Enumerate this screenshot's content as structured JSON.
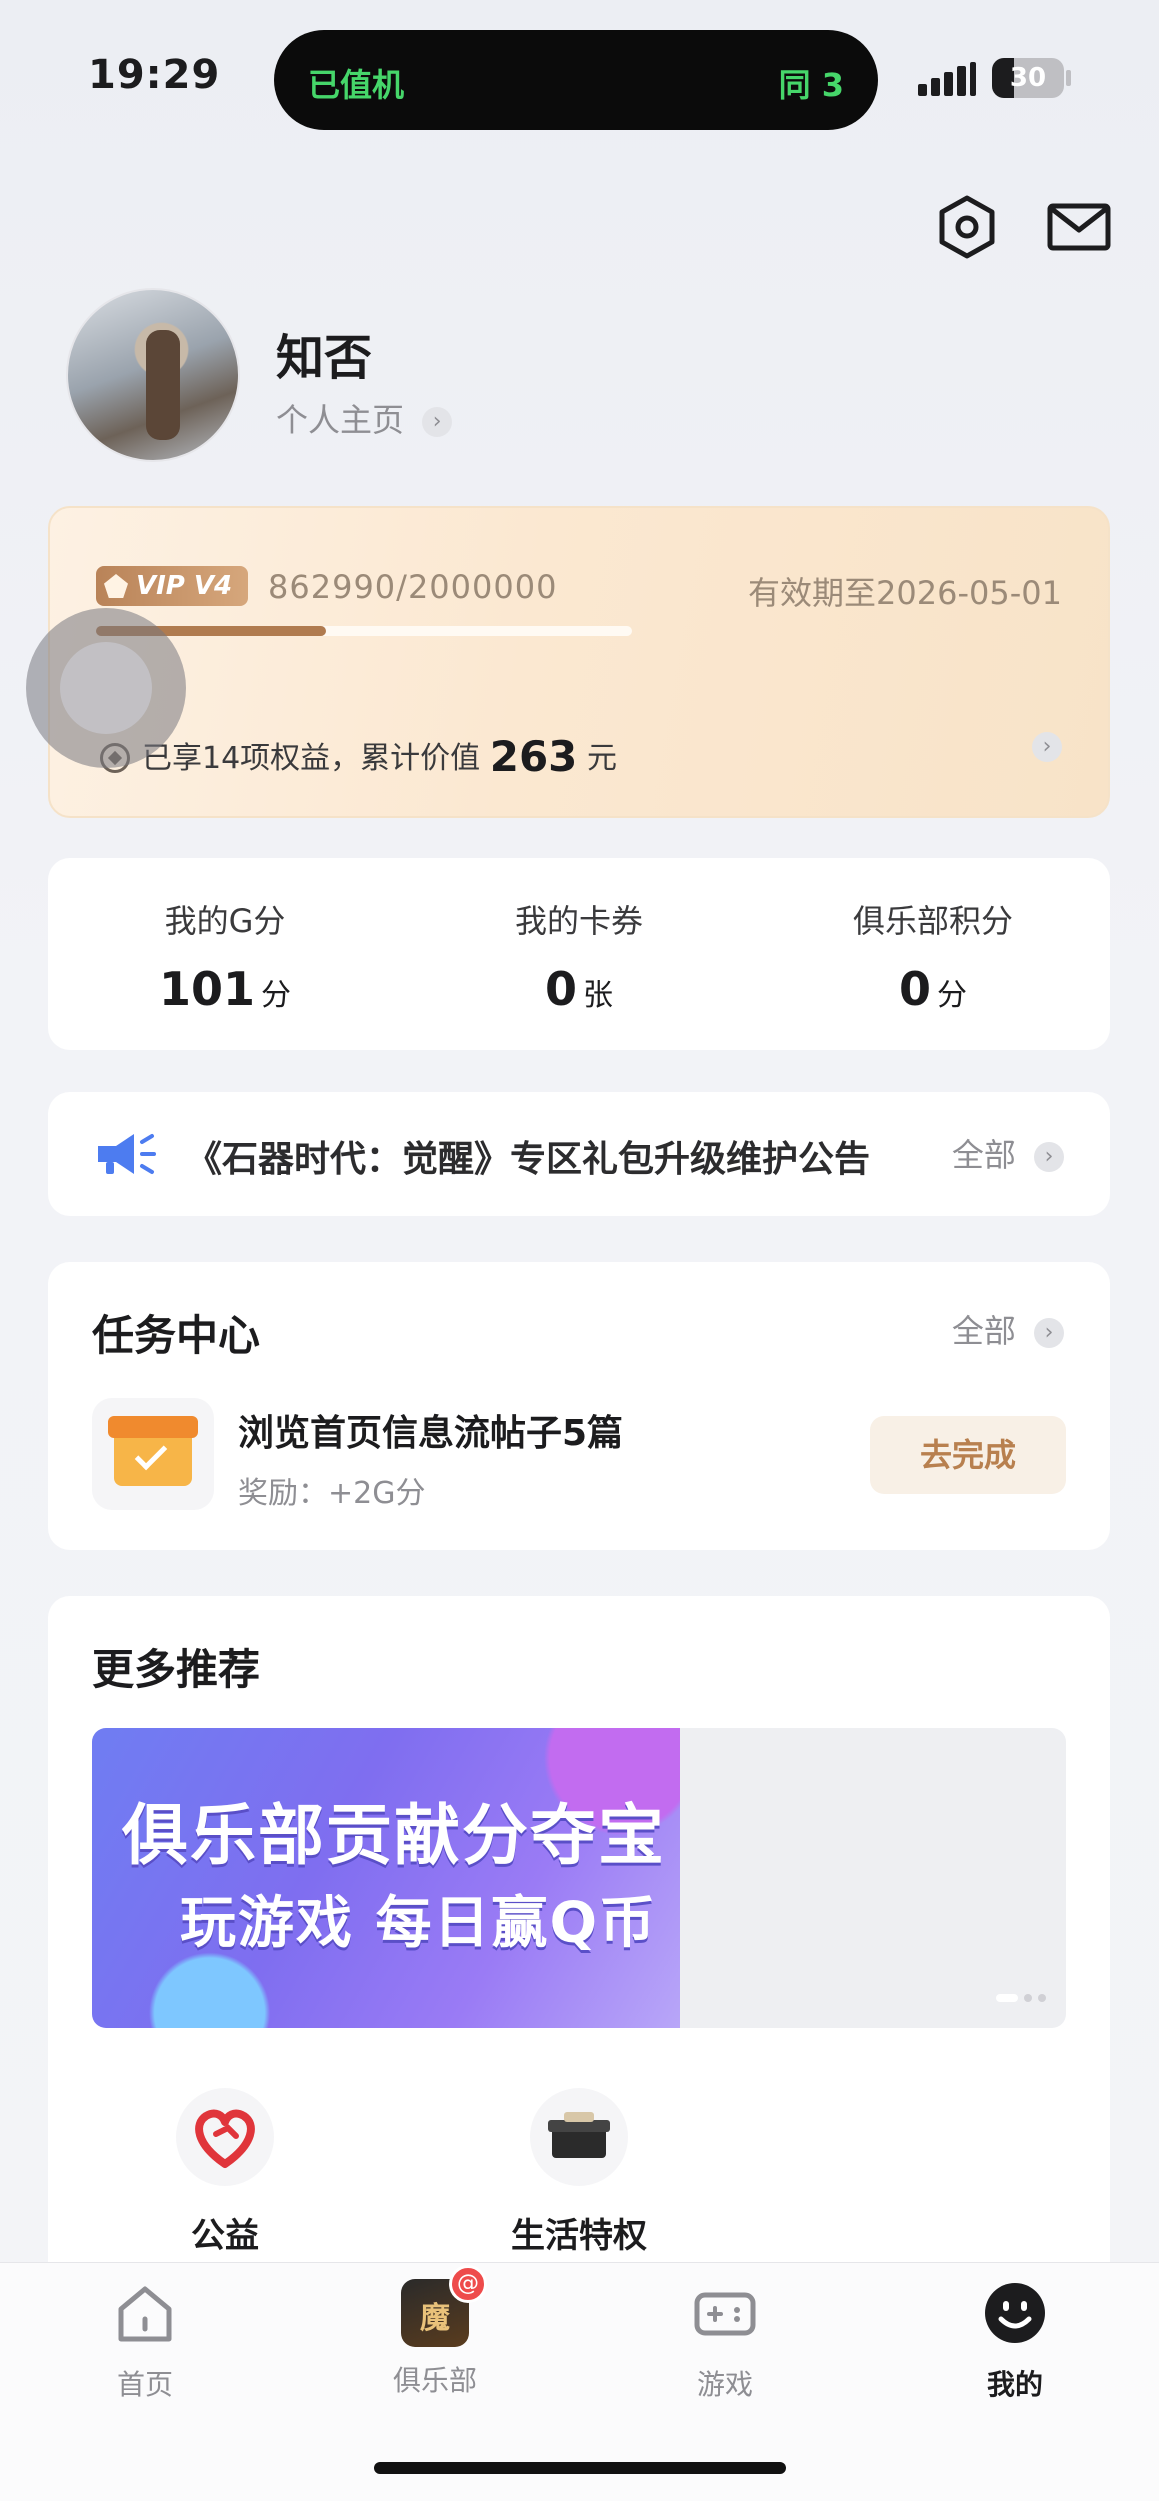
{
  "status_bar": {
    "time": "19:29",
    "island_left": "已值机",
    "island_right": "同 3",
    "battery": "30",
    "battery_level": 0.3
  },
  "header": {
    "icons": [
      "settings-icon",
      "mail-icon"
    ]
  },
  "profile": {
    "name": "知否",
    "homepage_link": "个人主页"
  },
  "vip": {
    "badge": "VIP V4",
    "progress_text": "862990/2000000",
    "progress_fraction": 0.43,
    "expire": "有效期至2026-05-01",
    "benefits_prefix": "已享14项权益，累计价值",
    "benefits_amount": "263",
    "benefits_suffix": "元"
  },
  "stats": [
    {
      "label": "我的G分",
      "value": "101",
      "unit": "分"
    },
    {
      "label": "我的卡券",
      "value": "0",
      "unit": "张"
    },
    {
      "label": "俱乐部积分",
      "value": "0",
      "unit": "分"
    }
  ],
  "notice": {
    "text": "《石器时代：觉醒》专区礼包升级维护公告",
    "all": "全部"
  },
  "tasks": {
    "title": "任务中心",
    "all": "全部",
    "item": {
      "title": "浏览首页信息流帖子5篇",
      "reward": "奖励：+2G分",
      "button": "去完成"
    }
  },
  "more": {
    "title": "更多推荐",
    "banner_line1": "俱乐部贡献分夺宝",
    "banner_line2": "玩游戏 每日赢Q币",
    "items": [
      {
        "label": "公益",
        "icon": "heart-hands-icon"
      },
      {
        "label": "生活特权",
        "icon": "gift-box-icon"
      }
    ]
  },
  "tabbar": [
    {
      "label": "首页",
      "icon": "home-icon"
    },
    {
      "label": "俱乐部",
      "icon": "club-app-icon",
      "badge": "@"
    },
    {
      "label": "游戏",
      "icon": "gamepad-icon"
    },
    {
      "label": "我的",
      "icon": "smiley-icon",
      "active": true
    }
  ],
  "colors": {
    "accent_gold": "#b8804f",
    "island_text": "#46d66a",
    "badge_red": "#ee4b4b"
  }
}
